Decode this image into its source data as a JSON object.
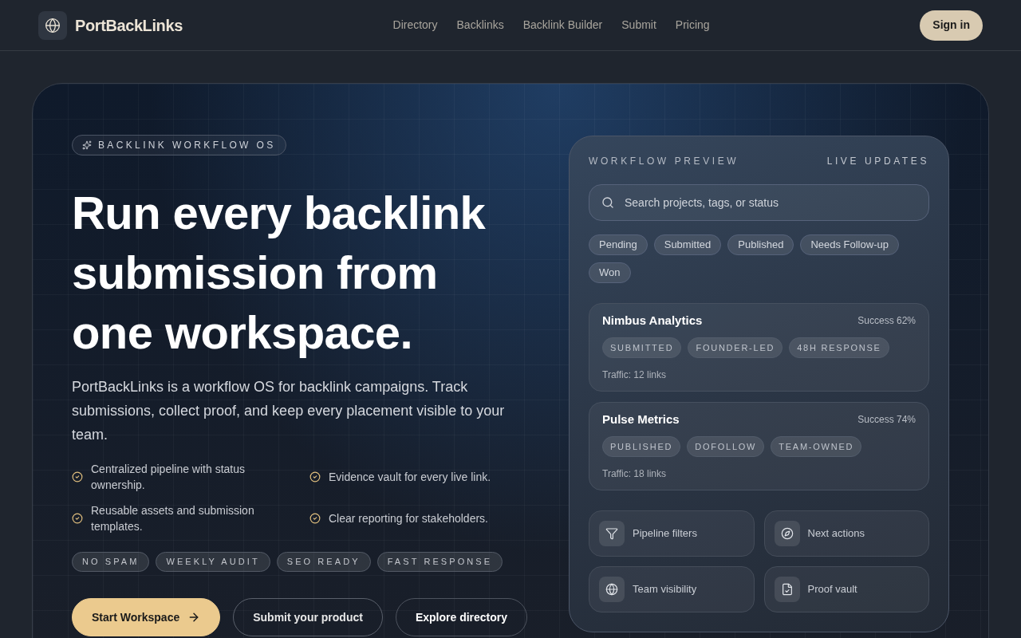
{
  "header": {
    "brand": "PortBackLinks",
    "nav": [
      "Directory",
      "Backlinks",
      "Backlink Builder",
      "Submit",
      "Pricing"
    ],
    "sign_in": "Sign in"
  },
  "hero": {
    "badge": "BACKLINK WORKFLOW OS",
    "headline": "Run every backlink submission from one workspace.",
    "description": "PortBackLinks is a workflow OS for backlink campaigns. Track submissions, collect proof, and keep every placement visible to your team.",
    "features": [
      "Centralized pipeline with status ownership.",
      "Evidence vault for every live link.",
      "Reusable assets and submission templates.",
      "Clear reporting for stakeholders."
    ],
    "tags": [
      "NO SPAM",
      "WEEKLY AUDIT",
      "SEO READY",
      "FAST RESPONSE"
    ],
    "buttons": [
      {
        "label": "Start Workspace",
        "kind": "primary"
      },
      {
        "label": "Submit your product",
        "kind": "secondary"
      },
      {
        "label": "Explore directory",
        "kind": "tertiary"
      }
    ]
  },
  "preview": {
    "title": "WORKFLOW PREVIEW",
    "status": "LIVE UPDATES",
    "search": {
      "placeholder": "Search projects, tags, or status"
    },
    "filters": [
      "Pending",
      "Submitted",
      "Published",
      "Needs Follow-up",
      "Won"
    ],
    "projects": [
      {
        "name": "Nimbus Analytics",
        "success": "Success 62%",
        "tags": [
          "SUBMITTED",
          "FOUNDER-LED",
          "48H RESPONSE"
        ],
        "traffic": "Traffic: 12 links"
      },
      {
        "name": "Pulse Metrics",
        "success": "Success 74%",
        "tags": [
          "PUBLISHED",
          "DOFOLLOW",
          "TEAM-OWNED"
        ],
        "traffic": "Traffic: 18 links"
      }
    ],
    "actions": [
      "Pipeline filters",
      "Next actions",
      "Team visibility",
      "Proof vault"
    ]
  }
}
